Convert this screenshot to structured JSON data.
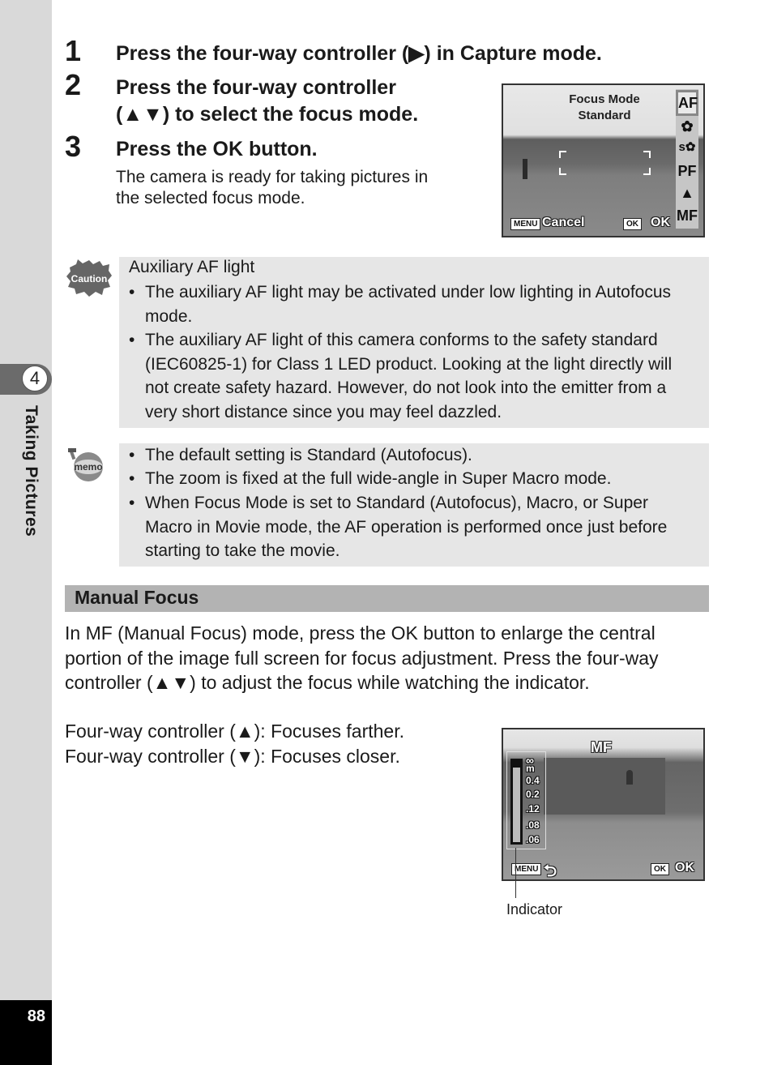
{
  "sidebar": {
    "chapter_number": "4",
    "chapter_title": "Taking Pictures",
    "page_number": "88"
  },
  "steps": [
    {
      "number": "1",
      "lines": [
        "Press the four-way controller (▶) in Capture mode."
      ]
    },
    {
      "number": "2",
      "lines": [
        "Press the four-way controller",
        "(▲▼) to select the focus mode."
      ]
    },
    {
      "number": "3",
      "lines": [
        "Press the OK button."
      ],
      "description": [
        "The camera is ready for taking pictures in",
        "the selected focus mode."
      ]
    }
  ],
  "screen1": {
    "title_line1": "Focus Mode",
    "title_line2": "Standard",
    "focus_modes": [
      {
        "label": "AF",
        "icon": "autofocus-icon",
        "selected": true
      },
      {
        "label": "✿",
        "icon": "macro-flower-icon",
        "selected": false
      },
      {
        "label": "s✿",
        "icon": "super-macro-icon",
        "selected": false
      },
      {
        "label": "PF",
        "icon": "pan-focus-icon",
        "selected": false
      },
      {
        "label": "▲",
        "icon": "infinity-landscape-mountain-icon",
        "selected": false
      },
      {
        "label": "MF",
        "icon": "manual-focus-icon",
        "selected": false
      }
    ],
    "menu_button": "MENU",
    "cancel_label": "Cancel",
    "ok_button": "OK",
    "ok_label": "OK"
  },
  "caution": {
    "icon": "caution-icon",
    "icon_text": "Caution",
    "title": "Auxiliary AF light",
    "bullets": [
      [
        "The auxiliary AF light may be activated under low lighting in Autofocus",
        "mode."
      ],
      [
        "The auxiliary AF light of this camera conforms to the safety standard",
        "(IEC60825-1) for Class 1 LED product. Looking at the light directly will",
        "not create safety hazard. However, do not look into the emitter from a",
        "very short distance since you may feel dazzled."
      ]
    ]
  },
  "memo": {
    "icon": "memo-icon",
    "icon_text": "memo",
    "bullets": [
      [
        "The default setting is Standard (Autofocus)."
      ],
      [
        "The zoom is fixed at the full wide-angle in Super Macro mode."
      ],
      [
        "When Focus Mode is set to Standard (Autofocus), Macro, or Super",
        "Macro in Movie mode, the AF operation is performed once just before",
        "starting to take the movie."
      ]
    ]
  },
  "manual_focus": {
    "section_title": "Manual Focus",
    "paragraph": [
      "In MF (Manual Focus) mode, press the OK button to enlarge the central",
      "portion of the image full screen for focus adjustment. Press the four-way",
      "controller (▲▼) to adjust the focus while watching the indicator."
    ],
    "controls": [
      "Four-way controller (▲): Focuses farther.",
      "Four-way controller (▼): Focuses closer."
    ]
  },
  "screen2": {
    "mode_label": "MF",
    "scale_labels": [
      "∞",
      "m",
      "0.4",
      "0.2",
      ".12",
      ".08",
      ".06"
    ],
    "indicator_position_fraction": 0.08,
    "menu_button": "MENU",
    "back_icon": "⮌",
    "ok_button": "OK",
    "ok_label": "OK",
    "callout_label": "Indicator"
  }
}
